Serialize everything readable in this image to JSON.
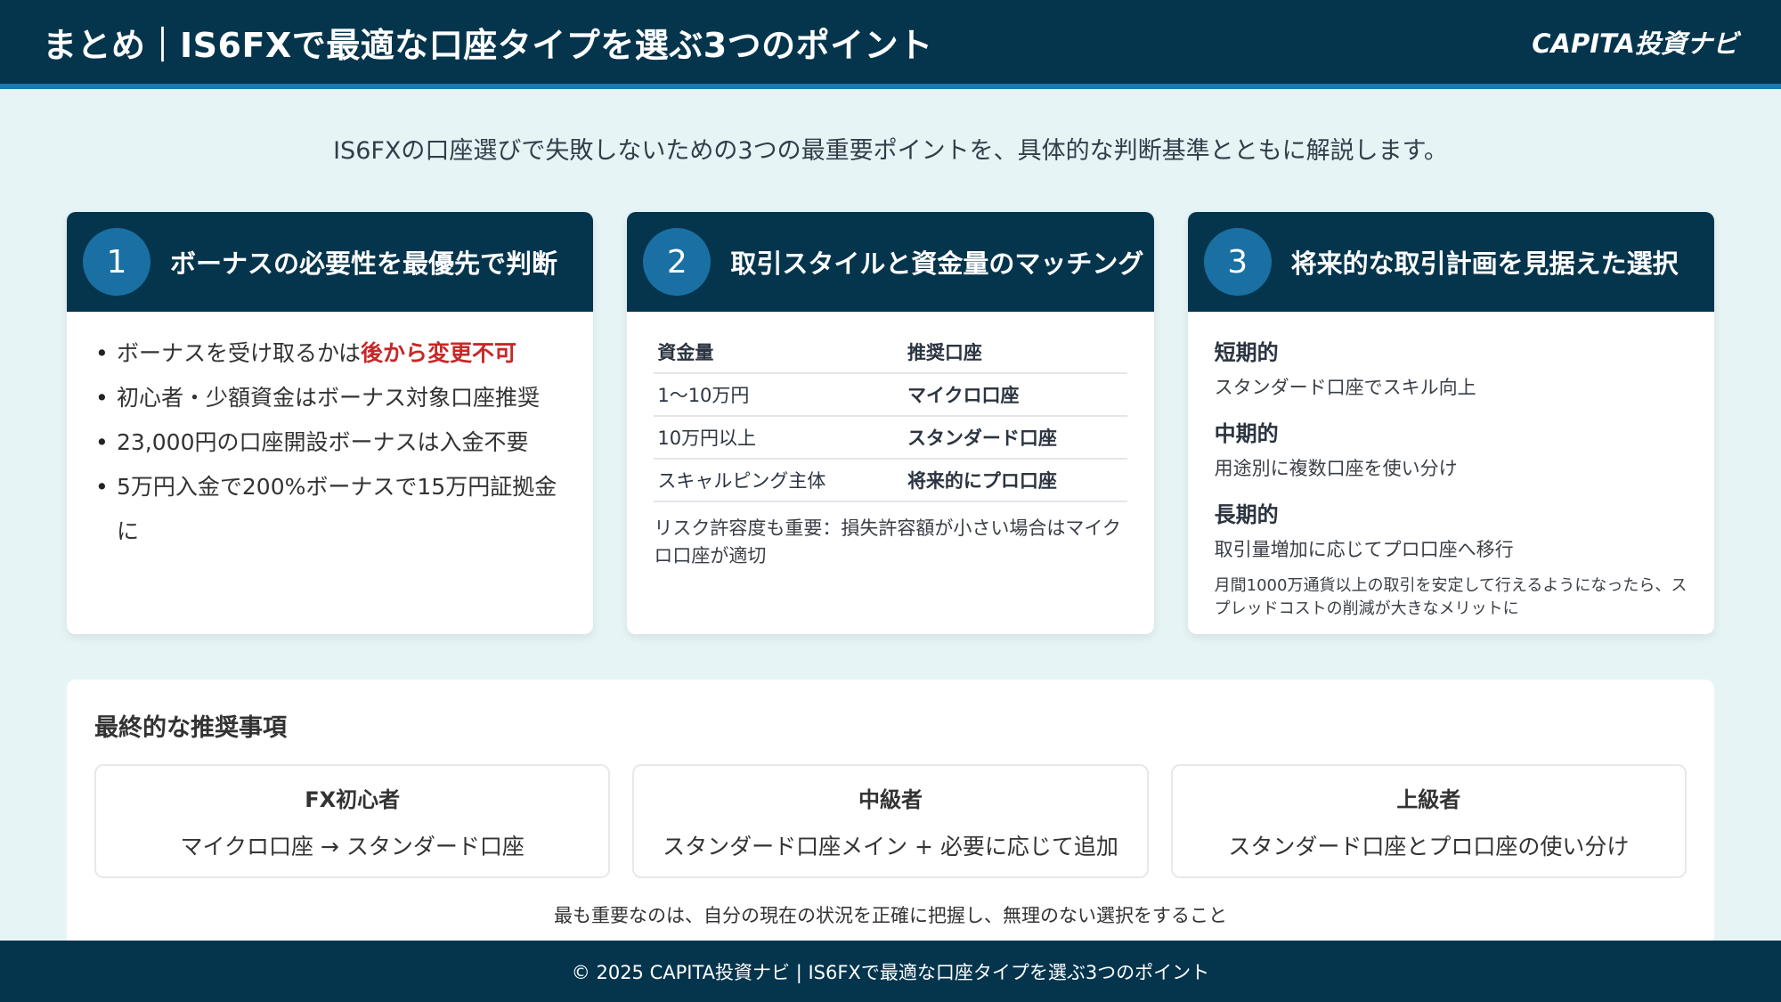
{
  "header": {
    "title": "まとめ｜IS6FXで最適な口座タイプを選ぶ3つのポイント",
    "brand": "CAPITA投資ナビ"
  },
  "intro": "IS6FXの口座選びで失敗しないための3つの最重要ポイントを、具体的な判断基準とともに解説します。",
  "cards": [
    {
      "number": "1",
      "title": "ボーナスの必要性を最優先で判断",
      "bullets": [
        {
          "text": "ボーナスを受け取るかは",
          "highlight": "後から変更不可"
        },
        {
          "text": "初心者・少額資金はボーナス対象口座推奨"
        },
        {
          "text": "23,000円の口座開設ボーナスは入金不要"
        },
        {
          "text": "5万円入金で200%ボーナスで15万円証拠金に"
        }
      ]
    },
    {
      "number": "2",
      "title": "取引スタイルと資金量のマッチング",
      "table": {
        "headers": [
          "資金量",
          "推奨口座"
        ],
        "rows": [
          [
            "1〜10万円",
            "マイクロ口座"
          ],
          [
            "10万円以上",
            "スタンダード口座"
          ],
          [
            "スキャルピング主体",
            "将来的にプロ口座"
          ]
        ]
      },
      "note": "リスク許容度も重要：損失許容額が小さい場合はマイクロ口座が適切"
    },
    {
      "number": "3",
      "title": "将来的な取引計画を見据えた選択",
      "terms": [
        {
          "label": "短期的",
          "desc": "スタンダード口座でスキル向上"
        },
        {
          "label": "中期的",
          "desc": "用途別に複数口座を使い分け"
        },
        {
          "label": "長期的",
          "desc": "取引量増加に応じてプロ口座へ移行"
        }
      ],
      "note": "月間1000万通貨以上の取引を安定して行えるようになったら、スプレッドコストの削減が大きなメリットに"
    }
  ],
  "final": {
    "title": "最終的な推奨事項",
    "boxes": [
      {
        "label": "FX初心者",
        "text": "マイクロ口座 → スタンダード口座"
      },
      {
        "label": "中級者",
        "text": "スタンダード口座メイン + 必要に応じて追加"
      },
      {
        "label": "上級者",
        "text": "スタンダード口座とプロ口座の使い分け"
      }
    ],
    "footnote": "最も重要なのは、自分の現在の状況を正確に把握し、無理のない選択をすること"
  },
  "footer": "© 2025 CAPITA投資ナビ | IS6FXで最適な口座タイプを選ぶ3つのポイント",
  "colors": {
    "navy": "#05354d",
    "accent_blue": "#1a6fa3",
    "highlight_red": "#c62828",
    "background": "#e6f4f6"
  }
}
